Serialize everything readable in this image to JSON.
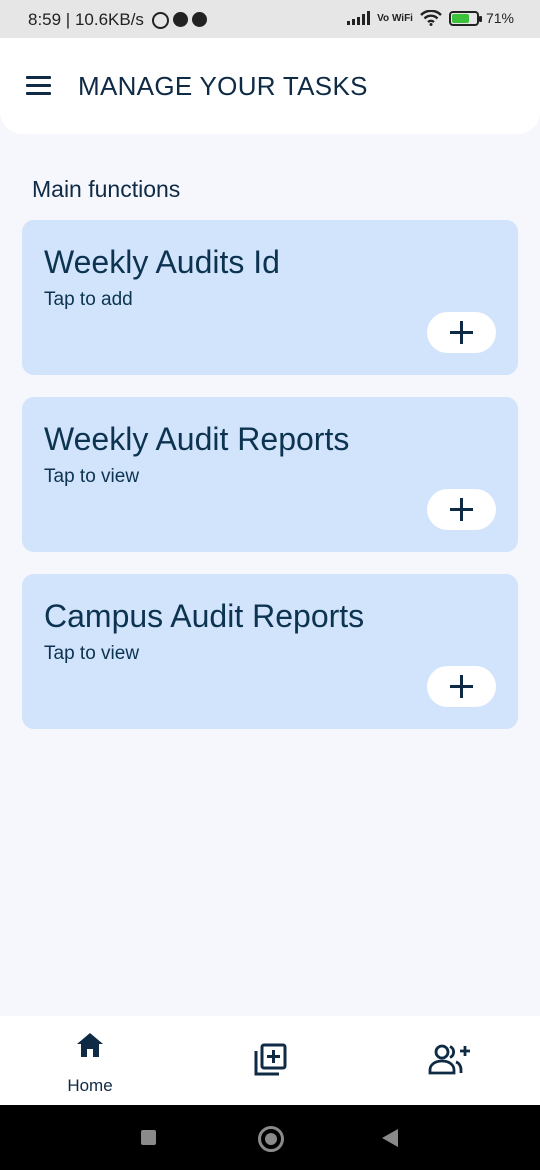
{
  "status_bar": {
    "time_speed": "8:59 | 10.6KB/s",
    "network_label": "Vo WiFi",
    "battery_percent": "71%",
    "battery_level": 0.71,
    "icons": [
      "alarm-icon",
      "app-notification-icon",
      "app-notification-icon",
      "signal-icon",
      "vowifi-icon",
      "wifi-icon",
      "battery-charging-icon"
    ]
  },
  "app_bar": {
    "title": "MANAGE YOUR TASKS",
    "menu_icon": "hamburger-menu-icon"
  },
  "main": {
    "section_title": "Main functions",
    "cards": [
      {
        "title": "Weekly Audits Id",
        "subtitle": "Tap to add",
        "action_icon": "plus-icon"
      },
      {
        "title": "Weekly Audit Reports",
        "subtitle": "Tap to view",
        "action_icon": "plus-icon"
      },
      {
        "title": "Campus Audit Reports",
        "subtitle": "Tap to view",
        "action_icon": "plus-icon"
      }
    ]
  },
  "bottom_nav": {
    "items": [
      {
        "icon": "home-icon",
        "label": "Home"
      },
      {
        "icon": "add-to-collection-icon",
        "label": ""
      },
      {
        "icon": "add-user-icon",
        "label": ""
      }
    ]
  },
  "system_nav": {
    "buttons": [
      "recent-apps-icon",
      "home-button-icon",
      "back-icon"
    ]
  },
  "colors": {
    "background": "#f5f7fc",
    "card": "#d2e3fc",
    "text": "#0f2a45",
    "app_bar": "#ffffff"
  }
}
